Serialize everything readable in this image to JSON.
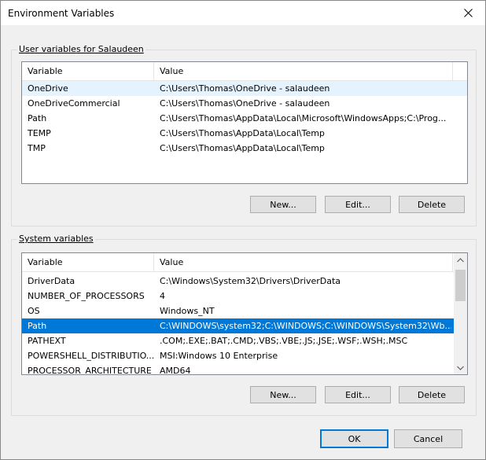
{
  "window": {
    "title": "Environment Variables",
    "close_icon": "close-icon"
  },
  "user_vars": {
    "group_label": "User variables for Salaudeen",
    "col_variable": "Variable",
    "col_value": "Value",
    "rows": [
      {
        "variable": "OneDrive",
        "value": "C:\\Users\\Thomas\\OneDrive - salaudeen"
      },
      {
        "variable": "OneDriveCommercial",
        "value": "C:\\Users\\Thomas\\OneDrive - salaudeen"
      },
      {
        "variable": "Path",
        "value": "C:\\Users\\Thomas\\AppData\\Local\\Microsoft\\WindowsApps;C:\\Prog..."
      },
      {
        "variable": "TEMP",
        "value": "C:\\Users\\Thomas\\AppData\\Local\\Temp"
      },
      {
        "variable": "TMP",
        "value": "C:\\Users\\Thomas\\AppData\\Local\\Temp"
      }
    ],
    "buttons": {
      "new": "New...",
      "edit": "Edit...",
      "delete": "Delete"
    }
  },
  "system_vars": {
    "group_label": "System variables",
    "col_variable": "Variable",
    "col_value": "Value",
    "rows": [
      {
        "variable": "DriverData",
        "value": "C:\\Windows\\System32\\Drivers\\DriverData"
      },
      {
        "variable": "NUMBER_OF_PROCESSORS",
        "value": "4"
      },
      {
        "variable": "OS",
        "value": "Windows_NT"
      },
      {
        "variable": "Path",
        "value": "C:\\WINDOWS\\system32;C:\\WINDOWS;C:\\WINDOWS\\System32\\Wb..."
      },
      {
        "variable": "PATHEXT",
        "value": ".COM;.EXE;.BAT;.CMD;.VBS;.VBE;.JS;.JSE;.WSF;.WSH;.MSC"
      },
      {
        "variable": "POWERSHELL_DISTRIBUTIO...",
        "value": "MSI:Windows 10 Enterprise"
      },
      {
        "variable": "PROCESSOR_ARCHITECTURE",
        "value": "AMD64"
      }
    ],
    "buttons": {
      "new": "New...",
      "edit": "Edit...",
      "delete": "Delete"
    }
  },
  "footer": {
    "ok": "OK",
    "cancel": "Cancel"
  },
  "colors": {
    "selection": "#0078d7",
    "hover": "#e5f3ff"
  }
}
